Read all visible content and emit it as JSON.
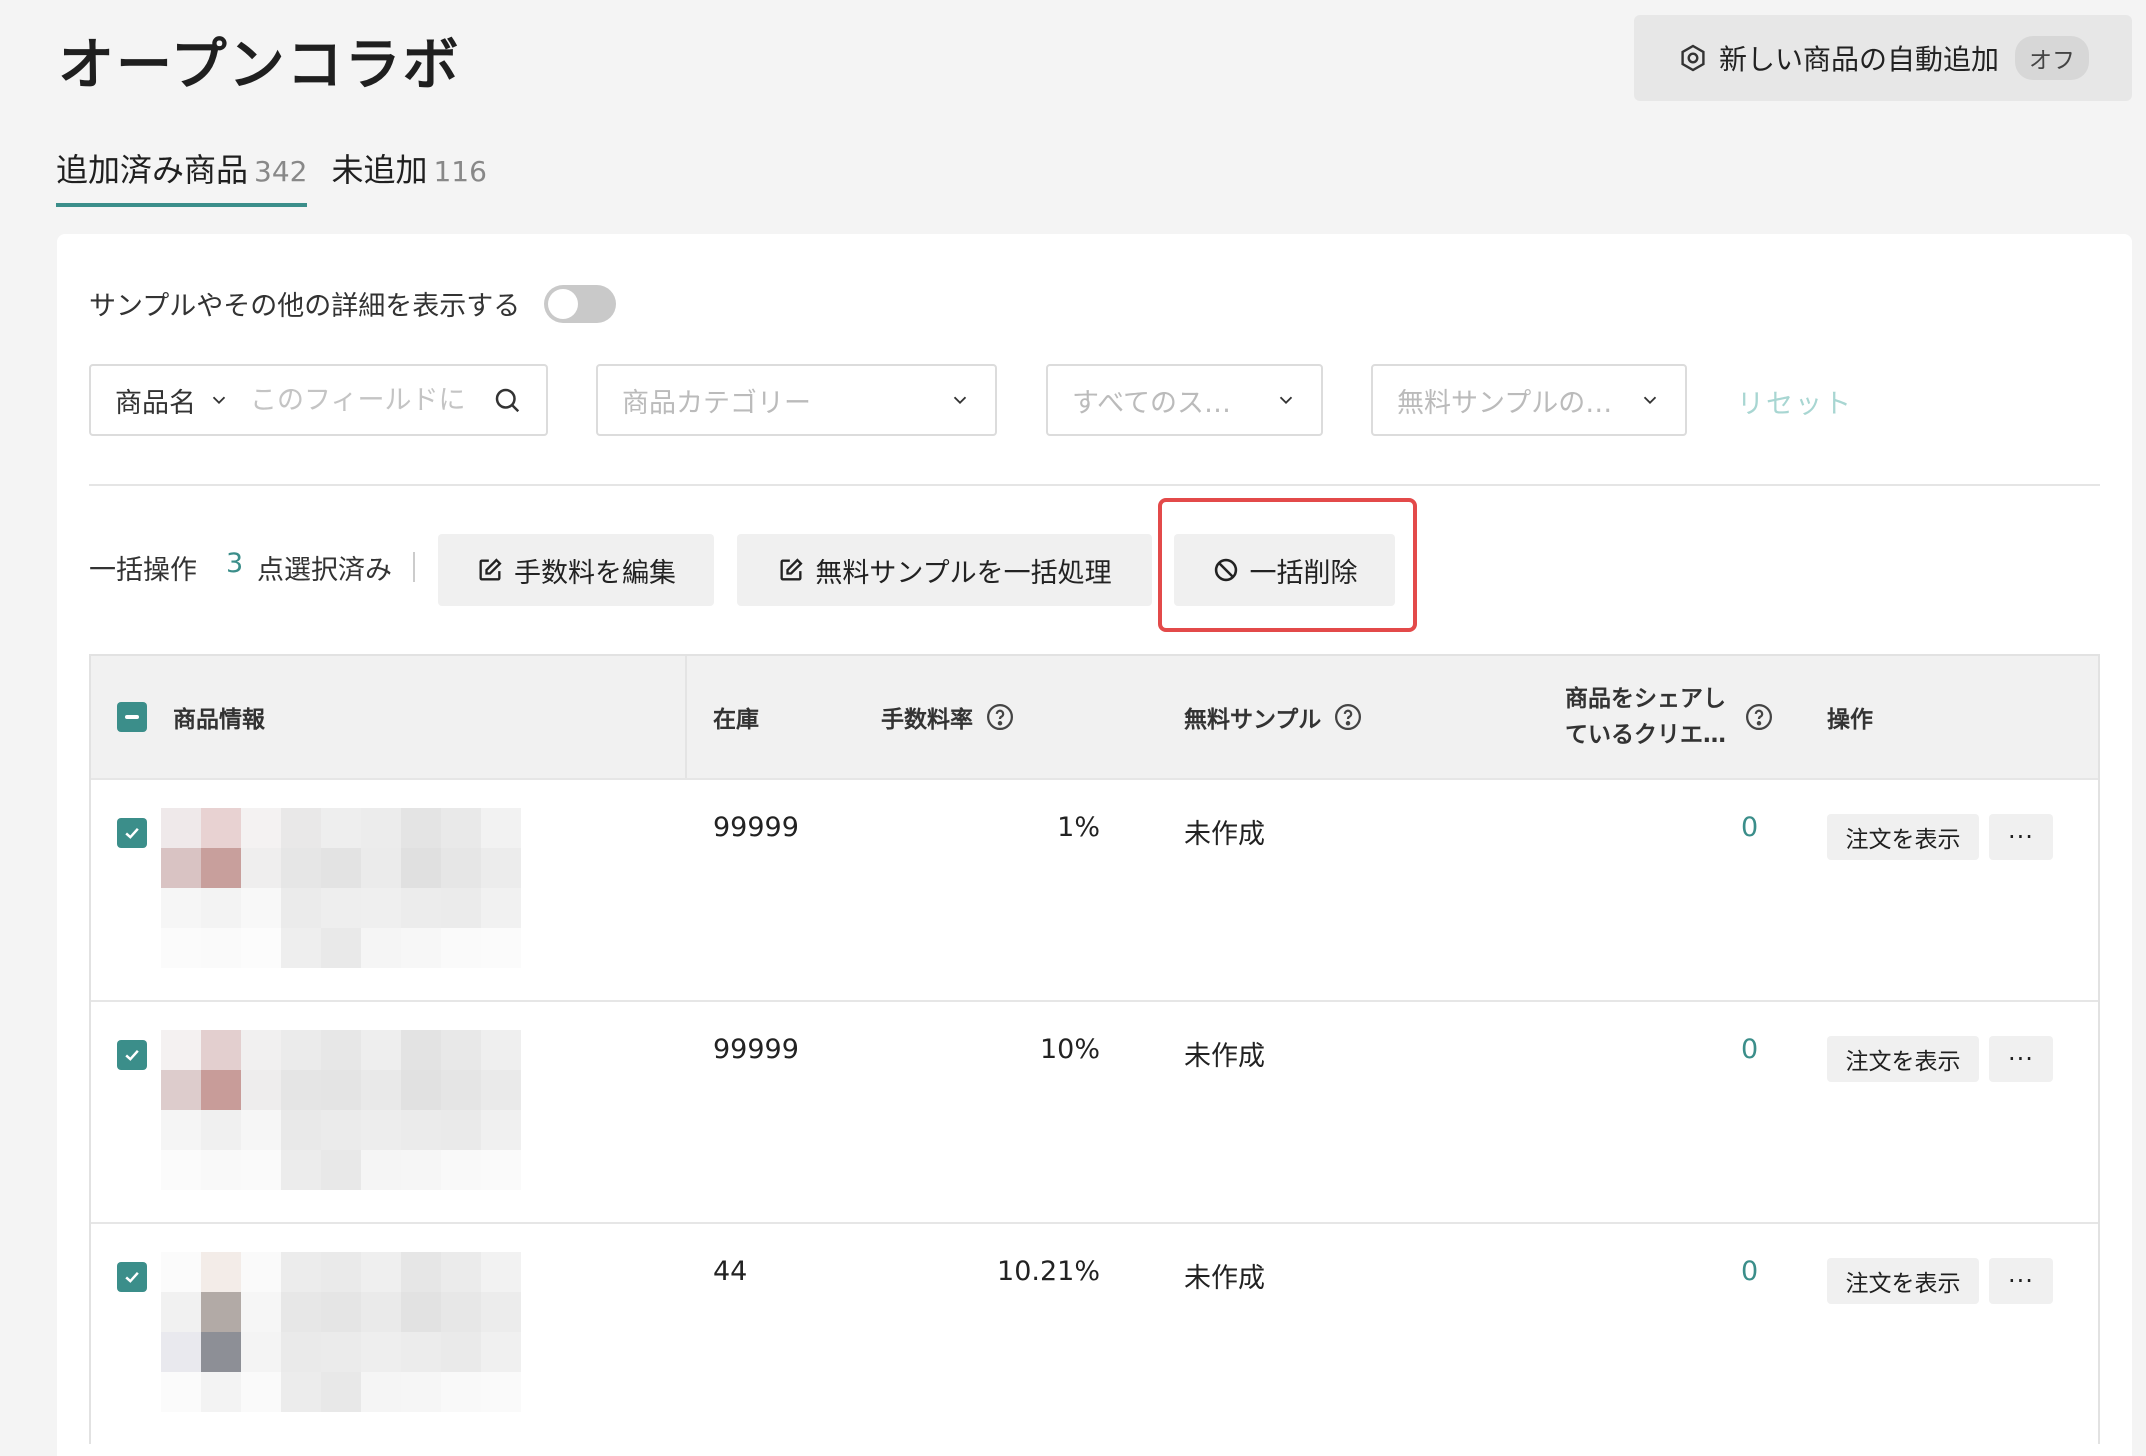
{
  "page": {
    "title": "オープンコラボ"
  },
  "auto_add": {
    "label": "新しい商品の自動追加",
    "state": "オフ",
    "icon": "gear-icon"
  },
  "tabs": [
    {
      "label": "追加済み商品",
      "count": "342",
      "active": true
    },
    {
      "label": "未追加",
      "count": "116",
      "active": false
    }
  ],
  "detail_toggle": {
    "label": "サンプルやその他の詳細を表示する",
    "on": false
  },
  "filters": {
    "field_select": "商品名",
    "search_placeholder": "このフィールドに",
    "category_placeholder": "商品カテゴリー",
    "status_placeholder": "すべてのス…",
    "sample_placeholder": "無料サンプルの…",
    "reset_label": "リセット"
  },
  "bulk": {
    "label": "一括操作",
    "count": "3",
    "selected_suffix": "点選択済み",
    "edit_fee": "手数料を編集",
    "sample_bulk": "無料サンプルを一括処理",
    "bulk_delete": "一括削除"
  },
  "table": {
    "headers": {
      "product": "商品情報",
      "stock": "在庫",
      "fee_rate": "手数料率",
      "free_sample": "無料サンプル",
      "share_line1": "商品をシェアし",
      "share_line2": "ているクリエ…",
      "actions": "操作"
    },
    "rows": [
      {
        "stock": "99999",
        "rate": "1%",
        "sample": "未作成",
        "creators": "0",
        "order_btn": "注文を表示",
        "more": "···"
      },
      {
        "stock": "99999",
        "rate": "10%",
        "sample": "未作成",
        "creators": "0",
        "order_btn": "注文を表示",
        "more": "···"
      },
      {
        "stock": "44",
        "rate": "10.21%",
        "sample": "未作成",
        "creators": "0",
        "order_btn": "注文を表示",
        "more": "···"
      }
    ]
  },
  "colors": {
    "accent": "#3b8e8a",
    "highlight": "#e34a4a",
    "reset": "#a8d6d2"
  }
}
